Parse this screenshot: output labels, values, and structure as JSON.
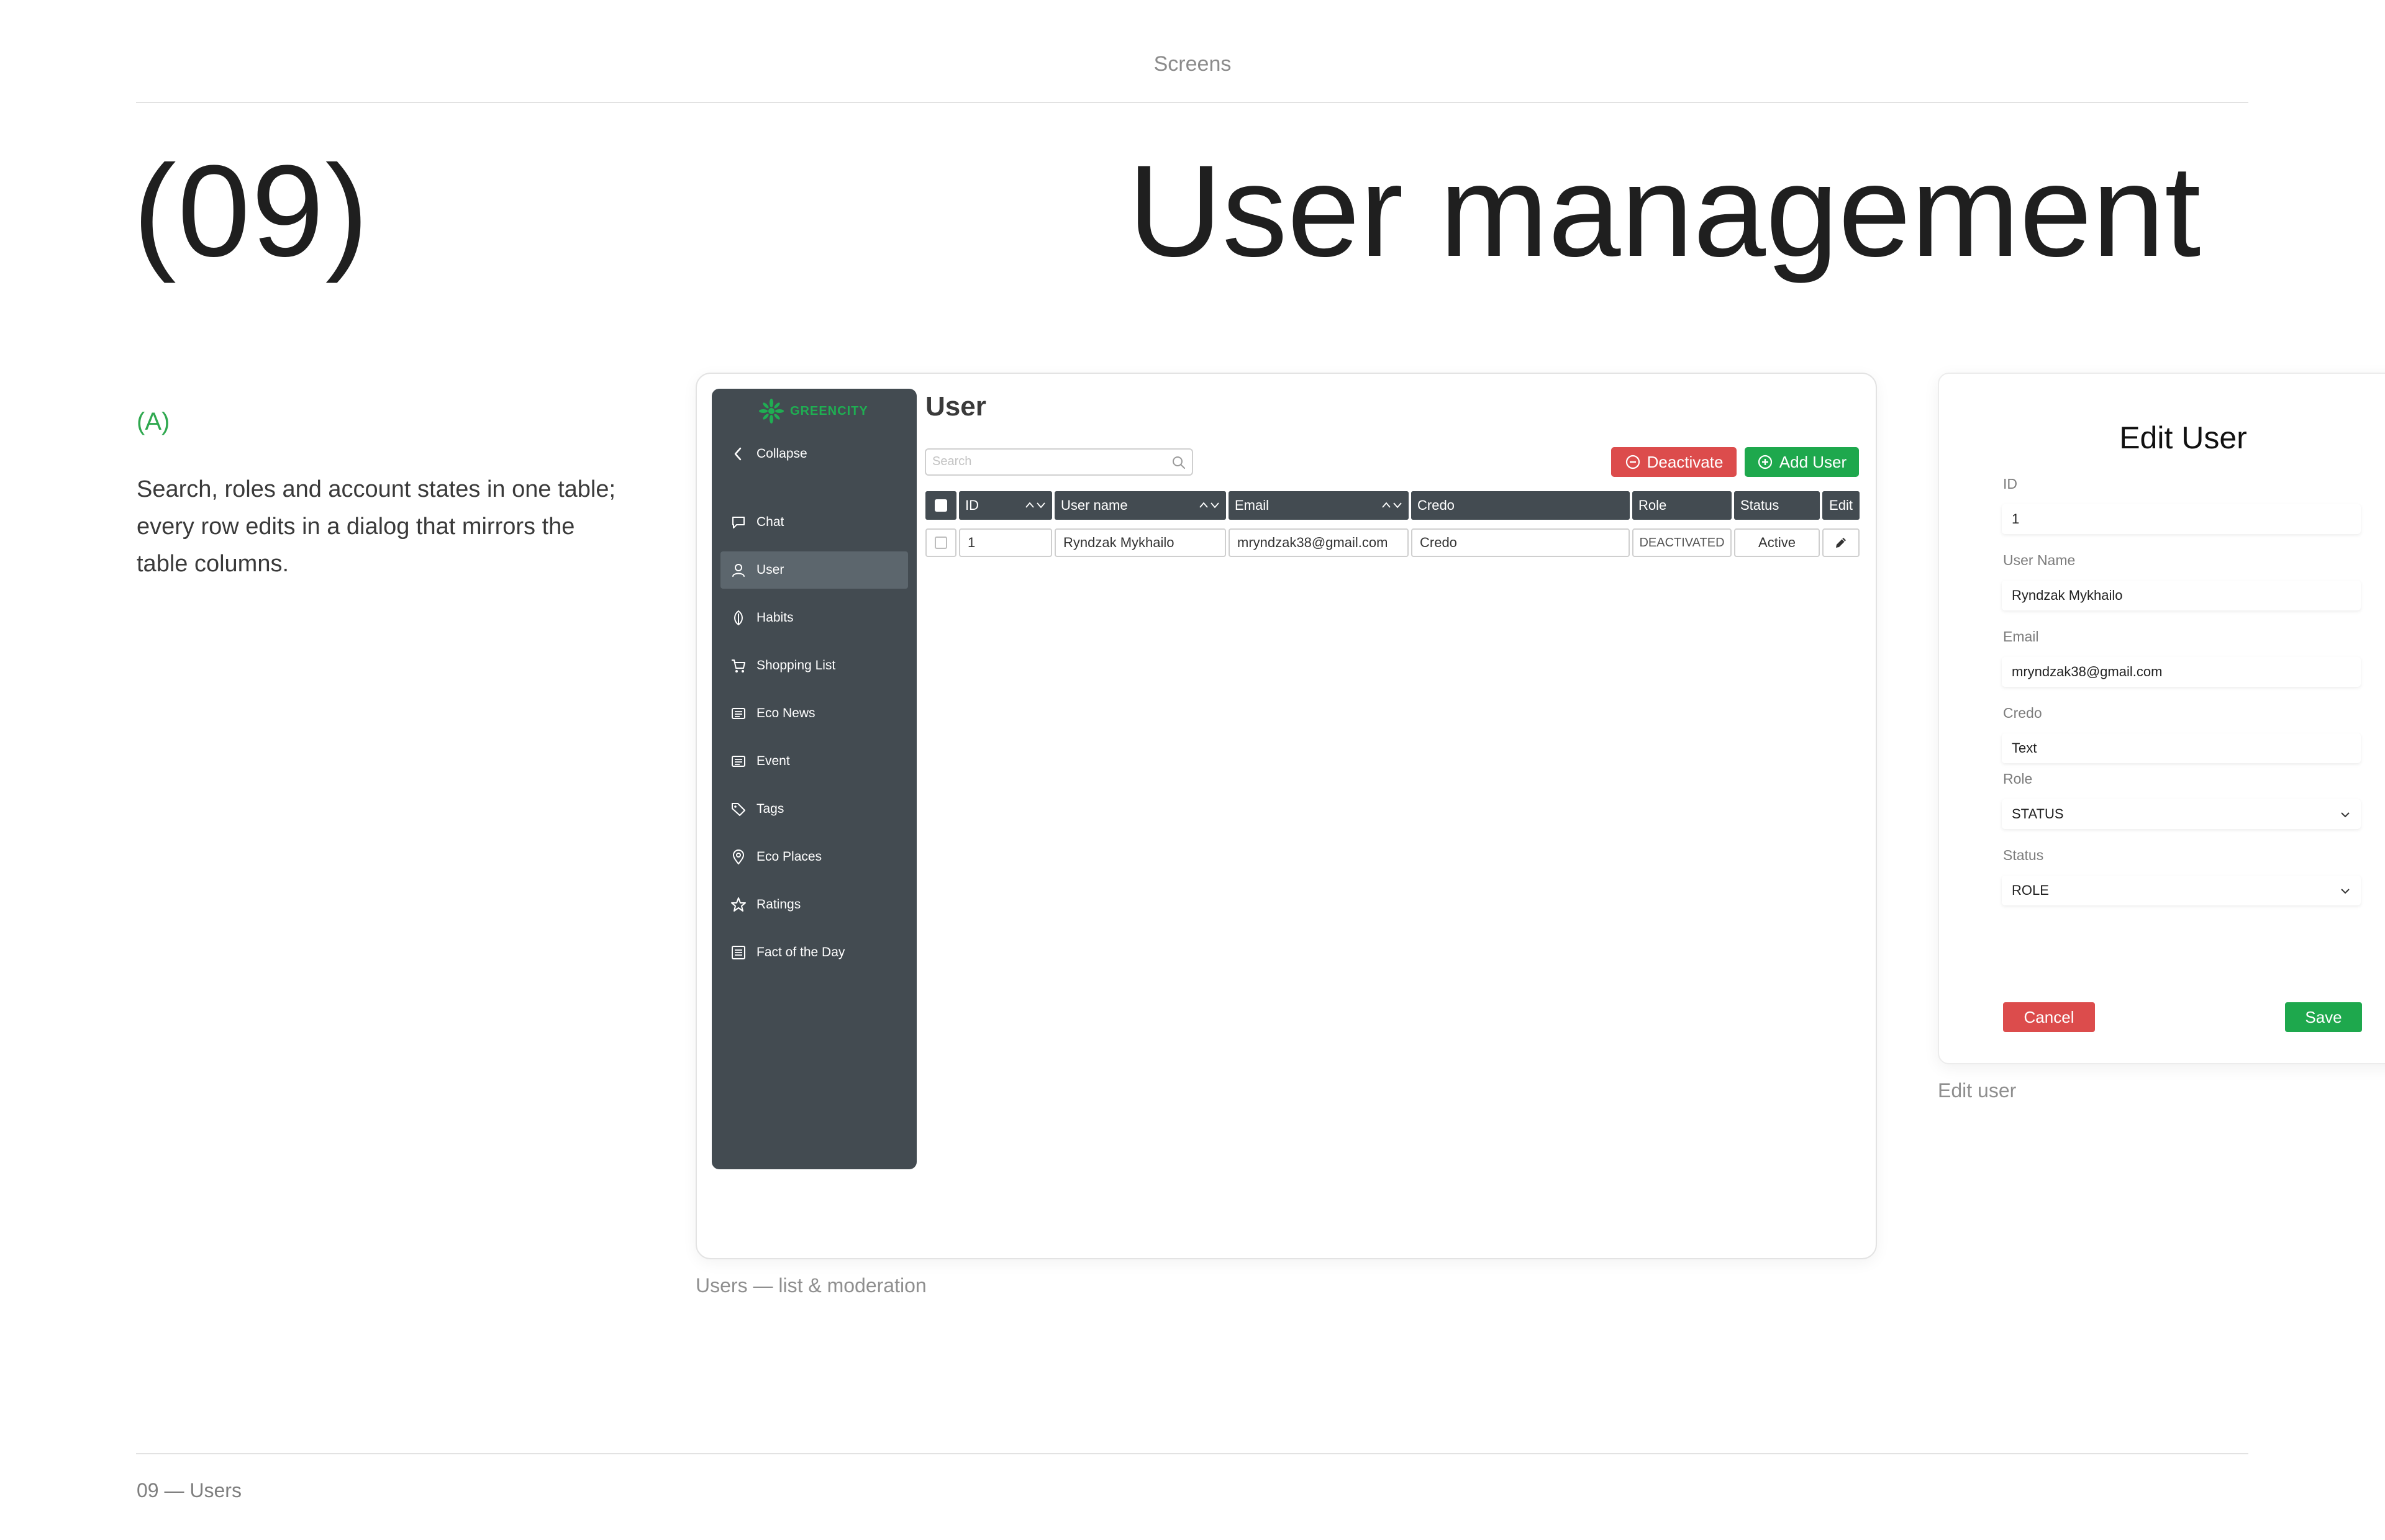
{
  "page": {
    "section_label": "Screens",
    "number": "(09)",
    "title": "User management",
    "tag": "(A)",
    "description": "Search, roles and account states in one table; every row edits in a dialog that mirrors the table columns.",
    "footer": "09 — Users"
  },
  "screen_main": {
    "caption": "Users — list & moderation",
    "logo_text": "GREENCITY",
    "sidebar": {
      "collapse_label": "Collapse",
      "items": [
        {
          "label": "Chat",
          "icon": "chat-icon"
        },
        {
          "label": "User",
          "icon": "user-icon",
          "active": true
        },
        {
          "label": "Habits",
          "icon": "leaf-icon"
        },
        {
          "label": "Shopping List",
          "icon": "cart-icon"
        },
        {
          "label": "Eco News",
          "icon": "news-icon"
        },
        {
          "label": "Event",
          "icon": "event-icon"
        },
        {
          "label": "Tags",
          "icon": "tag-icon"
        },
        {
          "label": "Eco Places",
          "icon": "map-pin-icon"
        },
        {
          "label": "Ratings",
          "icon": "star-icon"
        },
        {
          "label": "Fact of the Day",
          "icon": "document-icon"
        }
      ]
    },
    "header": {
      "title": "User",
      "search_placeholder": "Search",
      "deactivate_label": "Deactivate",
      "add_user_label": "Add User"
    },
    "table": {
      "columns": [
        "ID",
        "User name",
        "Email",
        "Credo",
        "Role",
        "Status",
        "Edit"
      ],
      "rows": [
        {
          "id": "1",
          "user_name": "Ryndzak Mykhailo",
          "email": "mryndzak38@gmail.com",
          "credo": "Credo",
          "role": "DEACTIVATED",
          "status": "Active"
        }
      ]
    },
    "colors": {
      "sidebar": "#434b51",
      "accent_green": "#1ea84d",
      "danger_red": "#dc4c4c"
    }
  },
  "screen_edit": {
    "caption": "Edit user",
    "title": "Edit User",
    "fields": {
      "id": {
        "label": "ID",
        "value": "1"
      },
      "user_name": {
        "label": "User Name",
        "value": "Ryndzak Mykhailo"
      },
      "email": {
        "label": "Email",
        "value": "mryndzak38@gmail.com"
      },
      "credo": {
        "label": "Credo",
        "value": "Text"
      },
      "role": {
        "label": "Role",
        "value": "STATUS"
      },
      "status": {
        "label": "Status",
        "value": "ROLE"
      }
    },
    "cancel_label": "Cancel",
    "save_label": "Save"
  }
}
